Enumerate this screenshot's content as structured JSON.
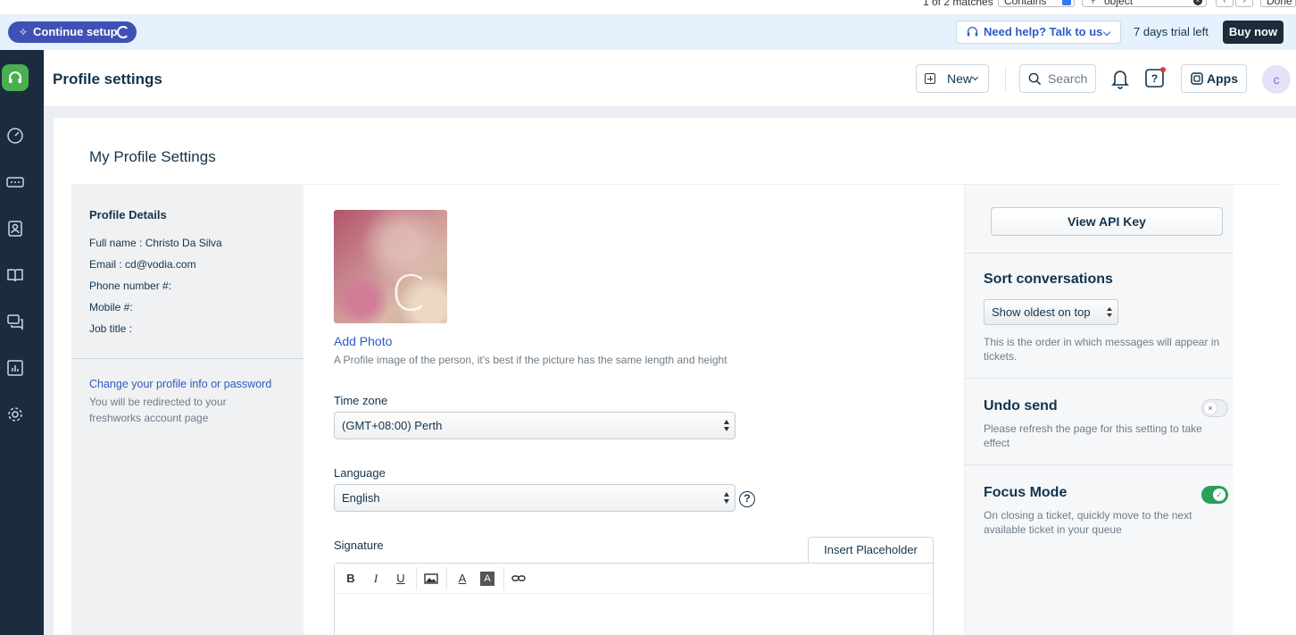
{
  "find_bar": {
    "matches": "1 of 2 matches",
    "mode": "Contains",
    "query": "object",
    "done_label": "Done"
  },
  "banner": {
    "setup_label": "Continue setup",
    "help_label": "Need help? Talk to us",
    "trial_text": "7 days trial left",
    "buy_label": "Buy now"
  },
  "sidebar": {
    "items": [
      "dashboard-icon",
      "tickets-icon",
      "contacts-icon",
      "knowledge-base-icon",
      "conversations-icon",
      "reports-icon",
      "settings-icon"
    ]
  },
  "header": {
    "title": "Profile settings",
    "new_label": "New",
    "search_placeholder": "Search",
    "apps_label": "Apps",
    "avatar_initial": "c"
  },
  "page": {
    "title": "My Profile Settings"
  },
  "profile_details": {
    "title": "Profile Details",
    "rows": [
      {
        "label": "Full name :",
        "value": "Christo Da Silva"
      },
      {
        "label": "Email :",
        "value": "cd@vodia.com"
      },
      {
        "label": "Phone number #:",
        "value": ""
      },
      {
        "label": "Mobile #:",
        "value": ""
      },
      {
        "label": "Job title :",
        "value": ""
      }
    ],
    "change_link": "Change your profile info or password",
    "redirect_note": "You will be redirected to your freshworks account page"
  },
  "photo": {
    "initial": "C",
    "add_label": "Add Photo",
    "help_text": "A Profile image of the person, it's best if the picture has the same length and height"
  },
  "timezone": {
    "label": "Time zone",
    "value": "(GMT+08:00) Perth"
  },
  "language": {
    "label": "Language",
    "value": "English"
  },
  "signature": {
    "label": "Signature",
    "insert_label": "Insert Placeholder",
    "toolbar": [
      "bold",
      "italic",
      "underline",
      "image",
      "font-color",
      "background-color",
      "link"
    ]
  },
  "right_panel": {
    "api_key_label": "View API Key",
    "sort": {
      "title": "Sort conversations",
      "value": "Show oldest on top",
      "note": "This is the order in which messages will appear in tickets."
    },
    "undo_send": {
      "title": "Undo send",
      "note": "Please refresh the page for this setting to take effect",
      "enabled": false
    },
    "focus_mode": {
      "title": "Focus Mode",
      "note": "On closing a ticket, quickly move to the next available ticket in your queue",
      "enabled": true
    }
  },
  "colors": {
    "accent": "#2c5cc5",
    "sidebar": "#1a2c3d",
    "logo": "#4bae4f",
    "setup_button": "#3f51b5",
    "toggle_on": "#2a9e5a"
  }
}
